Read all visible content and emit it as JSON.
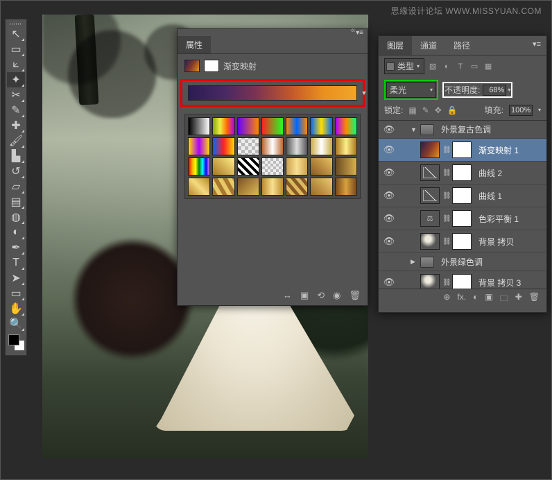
{
  "watermark": "思缘设计论坛  WWW.MISSYUAN.COM",
  "tools": [
    {
      "name": "move",
      "g": "↖"
    },
    {
      "name": "marquee",
      "g": "▭"
    },
    {
      "name": "lasso",
      "g": "⟀"
    },
    {
      "name": "magic-wand",
      "g": "✦"
    },
    {
      "name": "crop",
      "g": "✂"
    },
    {
      "name": "eyedropper",
      "g": "✎"
    },
    {
      "name": "heal",
      "g": "✚"
    },
    {
      "name": "brush",
      "g": "🖌"
    },
    {
      "name": "stamp",
      "g": "▙"
    },
    {
      "name": "history-brush",
      "g": "↺"
    },
    {
      "name": "eraser",
      "g": "▱"
    },
    {
      "name": "gradient",
      "g": "▤"
    },
    {
      "name": "blur",
      "g": "◍"
    },
    {
      "name": "dodge",
      "g": "◐"
    },
    {
      "name": "pen",
      "g": "✒"
    },
    {
      "name": "type",
      "g": "T"
    },
    {
      "name": "path-select",
      "g": "➤"
    },
    {
      "name": "shape",
      "g": "▭"
    },
    {
      "name": "hand",
      "g": "✋"
    },
    {
      "name": "zoom",
      "g": "🔍"
    }
  ],
  "properties": {
    "tab": "属性",
    "adjustment_label": "渐变映射",
    "footer_icons": [
      "↔",
      "▣",
      "⟲",
      "◉",
      "🗑"
    ]
  },
  "layers_panel": {
    "tabs": [
      "图层",
      "通道",
      "路径"
    ],
    "filter_label": "类型",
    "blend_mode": "柔光",
    "opacity_label": "不透明度:",
    "opacity_value": "68%",
    "lock_label": "锁定:",
    "fill_label": "填充:",
    "fill_value": "100%",
    "layers": [
      {
        "type": "group",
        "name": "外景复古色调",
        "open": true
      },
      {
        "type": "adj",
        "name": "渐变映射 1",
        "sel": true,
        "thumb": "grad"
      },
      {
        "type": "adj",
        "name": "曲线 2",
        "thumb": "curves"
      },
      {
        "type": "adj",
        "name": "曲线 1",
        "thumb": "curves"
      },
      {
        "type": "adj",
        "name": "色彩平衡 1",
        "thumb": "balance"
      },
      {
        "type": "layer",
        "name": "背景 拷贝",
        "thumb": "photo-s"
      },
      {
        "type": "group",
        "name": "外景绿色调",
        "open": false,
        "noeye": true
      },
      {
        "type": "layer",
        "name": "背景 拷贝 3",
        "thumb": "photo-s"
      }
    ],
    "footer_icons": [
      "⊕",
      "fx.",
      "◐",
      "▣",
      "🗀",
      "✚",
      "🗑"
    ]
  }
}
